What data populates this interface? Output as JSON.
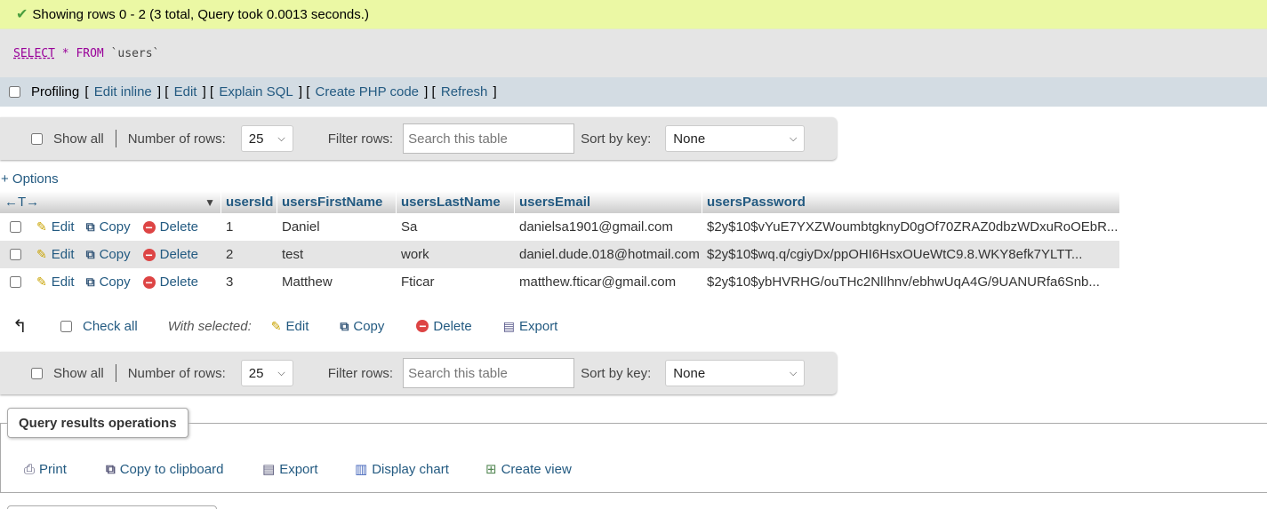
{
  "message": {
    "text": "Showing rows 0 - 2 (3 total, Query took 0.0013 seconds.)"
  },
  "sql": {
    "select": "SELECT",
    "star": "*",
    "from": "FROM",
    "table": "`users`"
  },
  "profiling": {
    "label": "Profiling",
    "links": [
      "Edit inline",
      "Edit",
      "Explain SQL",
      "Create PHP code",
      "Refresh"
    ]
  },
  "nav": {
    "show_all": "Show all",
    "number_of_rows_label": "Number of rows:",
    "number_of_rows_value": "25",
    "filter_label": "Filter rows:",
    "filter_placeholder": "Search this table",
    "sort_label": "Sort by key:",
    "sort_value": "None"
  },
  "options_link": "+ Options",
  "table": {
    "arrows": "←T→",
    "columns": [
      "usersId",
      "usersFirstName",
      "usersLastName",
      "usersEmail",
      "usersPassword"
    ],
    "action_labels": {
      "edit": "Edit",
      "copy": "Copy",
      "delete": "Delete"
    },
    "rows": [
      [
        "1",
        "Daniel",
        "Sa",
        "danielsa1901@gmail.com",
        "$2y$10$vYuE7YXZWoumbtgknyD0gOf70ZRAZ0dbzWDxuRoOEbR..."
      ],
      [
        "2",
        "test",
        "work",
        "daniel.dude.018@hotmail.com",
        "$2y$10$wq.q/cgiyDx/ppOHI6HsxOUeWtC9.8.WKY8efk7YLTT..."
      ],
      [
        "3",
        "Matthew",
        "Fticar",
        "matthew.fticar@gmail.com",
        "$2y$10$ybHVRHG/ouTHc2NlIhnv/ebhwUqA4G/9UANURfa6Snb..."
      ]
    ]
  },
  "with_selected": {
    "check_all": "Check all",
    "label": "With selected:",
    "edit": "Edit",
    "copy": "Copy",
    "delete": "Delete",
    "export": "Export"
  },
  "query_ops": {
    "legend": "Query results operations",
    "print": "Print",
    "copy_clipboard": "Copy to clipboard",
    "export": "Export",
    "display_chart": "Display chart",
    "create_view": "Create view"
  }
}
